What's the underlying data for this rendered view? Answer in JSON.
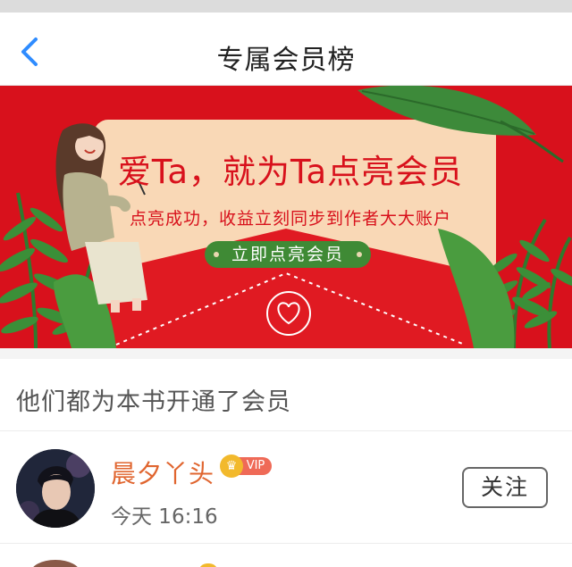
{
  "nav": {
    "title": "专属会员榜",
    "back_icon": "chevron-left-icon",
    "accent": "#2f8cff"
  },
  "banner": {
    "headline": "爱Ta，就为Ta点亮会员",
    "subline": "点亮成功，收益立刻同步到作者大大账户",
    "cta_label": "立即点亮会员",
    "background": "#d8111c"
  },
  "section": {
    "title": "他们都为本书开通了会员"
  },
  "members": [
    {
      "name": "晨夕丫头",
      "badge": "VIP",
      "time": "今天 16:16",
      "follow_label": "关注"
    }
  ]
}
